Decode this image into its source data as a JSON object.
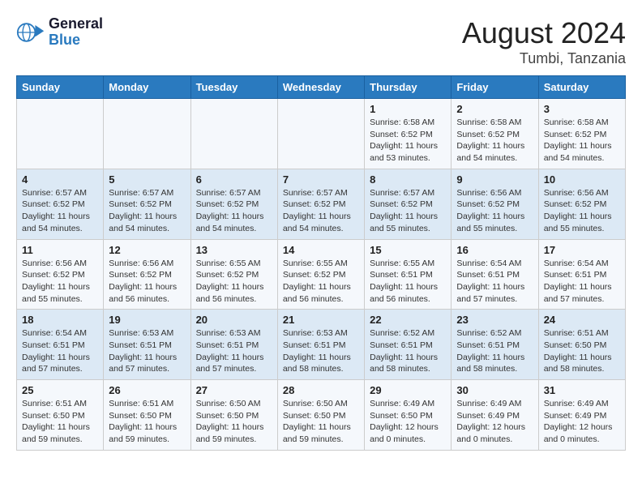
{
  "header": {
    "logo_line1": "General",
    "logo_line2": "Blue",
    "title": "August 2024",
    "subtitle": "Tumbi, Tanzania"
  },
  "days_of_week": [
    "Sunday",
    "Monday",
    "Tuesday",
    "Wednesday",
    "Thursday",
    "Friday",
    "Saturday"
  ],
  "weeks": [
    [
      {
        "day": "",
        "info": ""
      },
      {
        "day": "",
        "info": ""
      },
      {
        "day": "",
        "info": ""
      },
      {
        "day": "",
        "info": ""
      },
      {
        "day": "1",
        "info": "Sunrise: 6:58 AM\nSunset: 6:52 PM\nDaylight: 11 hours and 53 minutes."
      },
      {
        "day": "2",
        "info": "Sunrise: 6:58 AM\nSunset: 6:52 PM\nDaylight: 11 hours and 54 minutes."
      },
      {
        "day": "3",
        "info": "Sunrise: 6:58 AM\nSunset: 6:52 PM\nDaylight: 11 hours and 54 minutes."
      }
    ],
    [
      {
        "day": "4",
        "info": "Sunrise: 6:57 AM\nSunset: 6:52 PM\nDaylight: 11 hours and 54 minutes."
      },
      {
        "day": "5",
        "info": "Sunrise: 6:57 AM\nSunset: 6:52 PM\nDaylight: 11 hours and 54 minutes."
      },
      {
        "day": "6",
        "info": "Sunrise: 6:57 AM\nSunset: 6:52 PM\nDaylight: 11 hours and 54 minutes."
      },
      {
        "day": "7",
        "info": "Sunrise: 6:57 AM\nSunset: 6:52 PM\nDaylight: 11 hours and 54 minutes."
      },
      {
        "day": "8",
        "info": "Sunrise: 6:57 AM\nSunset: 6:52 PM\nDaylight: 11 hours and 55 minutes."
      },
      {
        "day": "9",
        "info": "Sunrise: 6:56 AM\nSunset: 6:52 PM\nDaylight: 11 hours and 55 minutes."
      },
      {
        "day": "10",
        "info": "Sunrise: 6:56 AM\nSunset: 6:52 PM\nDaylight: 11 hours and 55 minutes."
      }
    ],
    [
      {
        "day": "11",
        "info": "Sunrise: 6:56 AM\nSunset: 6:52 PM\nDaylight: 11 hours and 55 minutes."
      },
      {
        "day": "12",
        "info": "Sunrise: 6:56 AM\nSunset: 6:52 PM\nDaylight: 11 hours and 56 minutes."
      },
      {
        "day": "13",
        "info": "Sunrise: 6:55 AM\nSunset: 6:52 PM\nDaylight: 11 hours and 56 minutes."
      },
      {
        "day": "14",
        "info": "Sunrise: 6:55 AM\nSunset: 6:52 PM\nDaylight: 11 hours and 56 minutes."
      },
      {
        "day": "15",
        "info": "Sunrise: 6:55 AM\nSunset: 6:51 PM\nDaylight: 11 hours and 56 minutes."
      },
      {
        "day": "16",
        "info": "Sunrise: 6:54 AM\nSunset: 6:51 PM\nDaylight: 11 hours and 57 minutes."
      },
      {
        "day": "17",
        "info": "Sunrise: 6:54 AM\nSunset: 6:51 PM\nDaylight: 11 hours and 57 minutes."
      }
    ],
    [
      {
        "day": "18",
        "info": "Sunrise: 6:54 AM\nSunset: 6:51 PM\nDaylight: 11 hours and 57 minutes."
      },
      {
        "day": "19",
        "info": "Sunrise: 6:53 AM\nSunset: 6:51 PM\nDaylight: 11 hours and 57 minutes."
      },
      {
        "day": "20",
        "info": "Sunrise: 6:53 AM\nSunset: 6:51 PM\nDaylight: 11 hours and 57 minutes."
      },
      {
        "day": "21",
        "info": "Sunrise: 6:53 AM\nSunset: 6:51 PM\nDaylight: 11 hours and 58 minutes."
      },
      {
        "day": "22",
        "info": "Sunrise: 6:52 AM\nSunset: 6:51 PM\nDaylight: 11 hours and 58 minutes."
      },
      {
        "day": "23",
        "info": "Sunrise: 6:52 AM\nSunset: 6:51 PM\nDaylight: 11 hours and 58 minutes."
      },
      {
        "day": "24",
        "info": "Sunrise: 6:51 AM\nSunset: 6:50 PM\nDaylight: 11 hours and 58 minutes."
      }
    ],
    [
      {
        "day": "25",
        "info": "Sunrise: 6:51 AM\nSunset: 6:50 PM\nDaylight: 11 hours and 59 minutes."
      },
      {
        "day": "26",
        "info": "Sunrise: 6:51 AM\nSunset: 6:50 PM\nDaylight: 11 hours and 59 minutes."
      },
      {
        "day": "27",
        "info": "Sunrise: 6:50 AM\nSunset: 6:50 PM\nDaylight: 11 hours and 59 minutes."
      },
      {
        "day": "28",
        "info": "Sunrise: 6:50 AM\nSunset: 6:50 PM\nDaylight: 11 hours and 59 minutes."
      },
      {
        "day": "29",
        "info": "Sunrise: 6:49 AM\nSunset: 6:50 PM\nDaylight: 12 hours and 0 minutes."
      },
      {
        "day": "30",
        "info": "Sunrise: 6:49 AM\nSunset: 6:49 PM\nDaylight: 12 hours and 0 minutes."
      },
      {
        "day": "31",
        "info": "Sunrise: 6:49 AM\nSunset: 6:49 PM\nDaylight: 12 hours and 0 minutes."
      }
    ]
  ]
}
